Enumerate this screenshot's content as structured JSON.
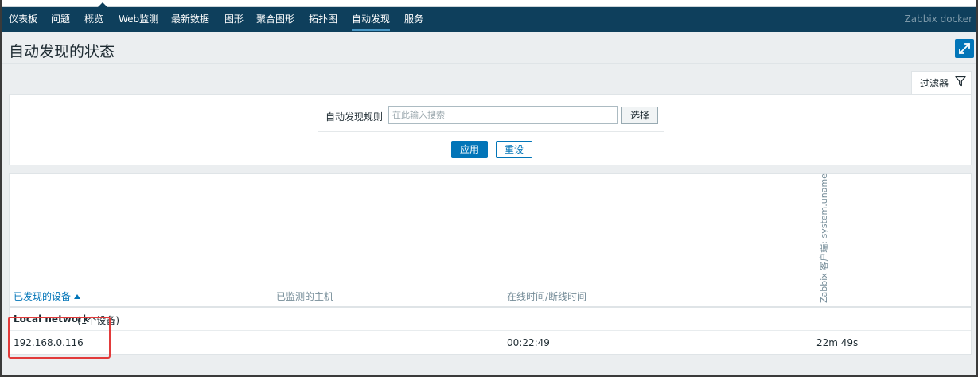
{
  "nav": {
    "items": [
      {
        "label": "仪表板"
      },
      {
        "label": "问题"
      },
      {
        "label": "概览"
      },
      {
        "label": "Web监测"
      },
      {
        "label": "最新数据"
      },
      {
        "label": "图形"
      },
      {
        "label": "聚合图形"
      },
      {
        "label": "拓扑图"
      },
      {
        "label": "自动发现",
        "active": true
      },
      {
        "label": "服务"
      }
    ],
    "brand": "Zabbix docker"
  },
  "header": {
    "title": "自动发现的状态",
    "fullscreen_icon": "expand-icon"
  },
  "filter": {
    "tab_label": "过滤器",
    "tab_icon": "filter-icon",
    "rule_label": "自动发现规则",
    "rule_placeholder": "在此输入搜索",
    "rule_value": "",
    "select_label": "选择",
    "apply_label": "应用",
    "reset_label": "重设"
  },
  "table": {
    "columns": {
      "discovered_device": "已发现的设备",
      "monitored_host": "已监测的主机",
      "uptime_downtime": "在线时间/断线时间",
      "check": "Zabbix 客户端: system.uname"
    },
    "sort_icon": "sort-ascending-icon",
    "groups": [
      {
        "name": "Local network",
        "count": "(1个设备)",
        "rows": [
          {
            "device": "192.168.0.116",
            "host": "",
            "uptime": "00:22:49",
            "check_value": "22m 49s"
          }
        ]
      }
    ]
  },
  "colors": {
    "nav_bg": "#0e3f5c",
    "accent": "#0275b8",
    "page_bg": "#ebeef0",
    "highlight": "#e23b3b"
  }
}
